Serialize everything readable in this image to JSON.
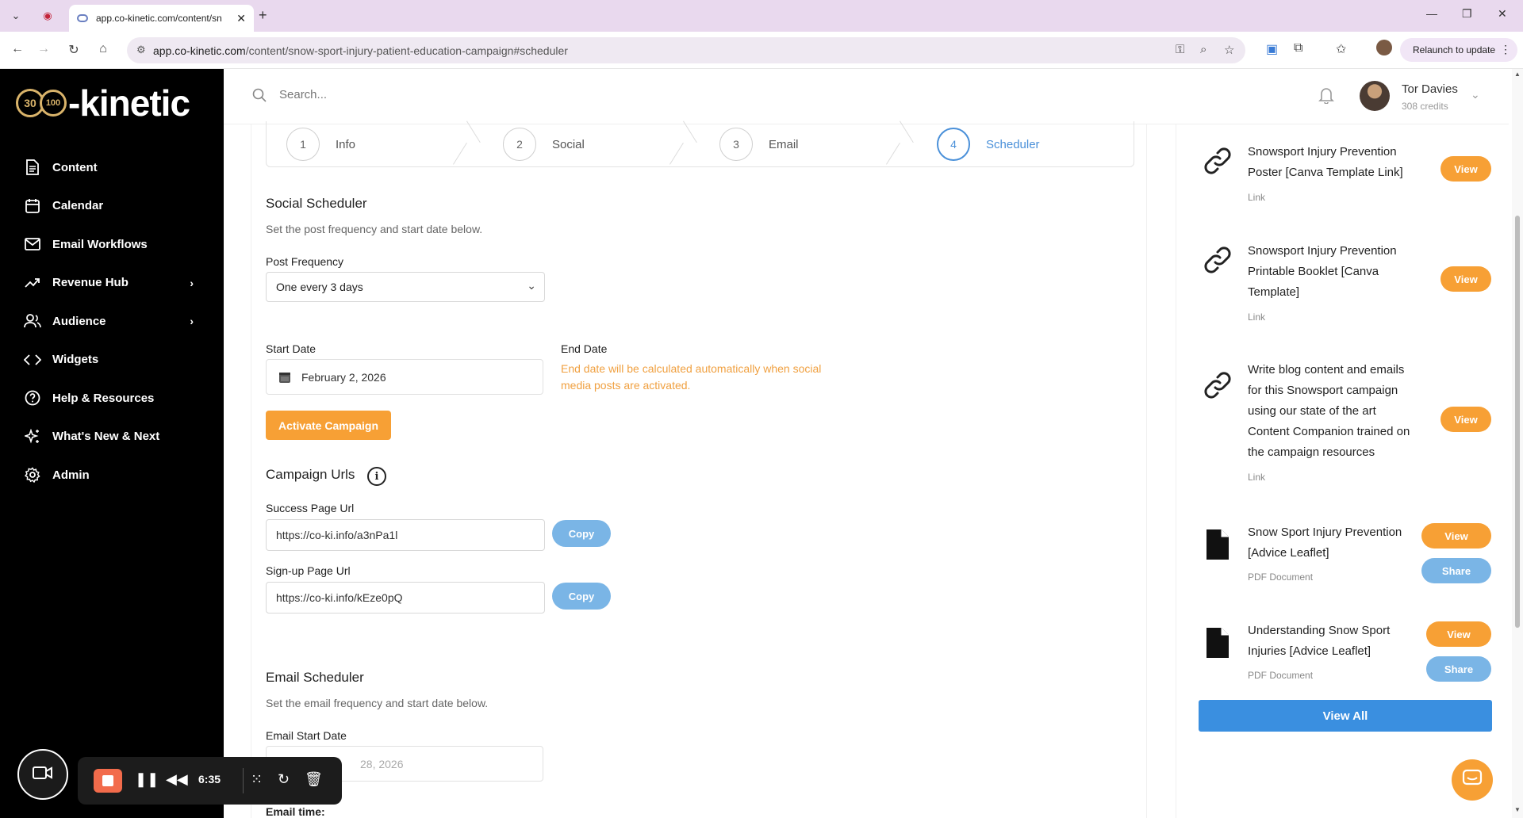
{
  "browser": {
    "tab_title": "app.co-kinetic.com/content/sn",
    "url_host": "app.co-kinetic.com",
    "url_path": "/content/snow-sport-injury-patient-education-campaign#scheduler",
    "relaunch_label": "Relaunch to update"
  },
  "brand": {
    "badge1": "30",
    "badge2": "100",
    "wordmark": "-kinetic",
    "gold": "#d9b36a"
  },
  "sidebar": {
    "items": [
      {
        "label": "Content",
        "icon": "document-icon"
      },
      {
        "label": "Calendar",
        "icon": "calendar-icon"
      },
      {
        "label": "Email Workflows",
        "icon": "mail-icon"
      },
      {
        "label": "Revenue Hub",
        "icon": "trend-icon"
      },
      {
        "label": "Audience",
        "icon": "users-icon"
      },
      {
        "label": "Widgets",
        "icon": "code-icon"
      },
      {
        "label": "Help & Resources",
        "icon": "help-icon"
      },
      {
        "label": "What's New & Next",
        "icon": "sparkle-icon"
      },
      {
        "label": "Admin",
        "icon": "gear-icon"
      }
    ]
  },
  "header": {
    "search_placeholder": "Search...",
    "user_name": "Tor Davies",
    "user_credits": "308 credits"
  },
  "steps": [
    {
      "num": "1",
      "label": "Info"
    },
    {
      "num": "2",
      "label": "Social"
    },
    {
      "num": "3",
      "label": "Email"
    },
    {
      "num": "4",
      "label": "Scheduler"
    }
  ],
  "social": {
    "title": "Social Scheduler",
    "subtitle": "Set the post frequency and start date below.",
    "frequency_label": "Post Frequency",
    "frequency_value": "One every 3 days",
    "start_label": "Start Date",
    "start_value": "February 2, 2026",
    "end_label": "End Date",
    "end_note": "End date will be calculated automatically when social media posts are activated.",
    "activate_label": "Activate Campaign"
  },
  "urls": {
    "title": "Campaign Urls",
    "success_label": "Success Page Url",
    "success_value": "https://co-ki.info/a3nPa1l",
    "signup_label": "Sign-up Page Url",
    "signup_value": "https://co-ki.info/kEze0pQ",
    "copy_label": "Copy"
  },
  "email": {
    "title": "Email Scheduler",
    "subtitle": "Set the email frequency and start date below.",
    "start_label": "Email Start Date",
    "start_value": "28, 2026",
    "time_label": "Email time:"
  },
  "resources": {
    "items": [
      {
        "title": "Snowsport Injury Prevention Poster [Canva Template Link]",
        "type": "Link",
        "icon": "link-icon",
        "view": "View"
      },
      {
        "title": "Snowsport Injury Prevention Printable Booklet [Canva Template]",
        "type": "Link",
        "icon": "link-icon",
        "view": "View"
      },
      {
        "title": "Write blog content and emails for this Snowsport campaign using our state of the art Content Companion trained on the campaign resources",
        "type": "Link",
        "icon": "link-icon",
        "view": "View"
      },
      {
        "title": "Snow Sport Injury Prevention [Advice Leaflet]",
        "type": "PDF Document",
        "icon": "file-icon",
        "view": "View",
        "share": "Share"
      },
      {
        "title": "Understanding Snow Sport Injuries [Advice Leaflet]",
        "type": "PDF Document",
        "icon": "file-icon",
        "view": "View",
        "share": "Share"
      }
    ],
    "view_all_label": "View All"
  },
  "recorder": {
    "time": "6:35"
  },
  "colors": {
    "accent_orange": "#f7a035",
    "accent_blue": "#3a8fe0",
    "light_blue": "#7ab5e6",
    "step_active": "#4a90d9"
  }
}
